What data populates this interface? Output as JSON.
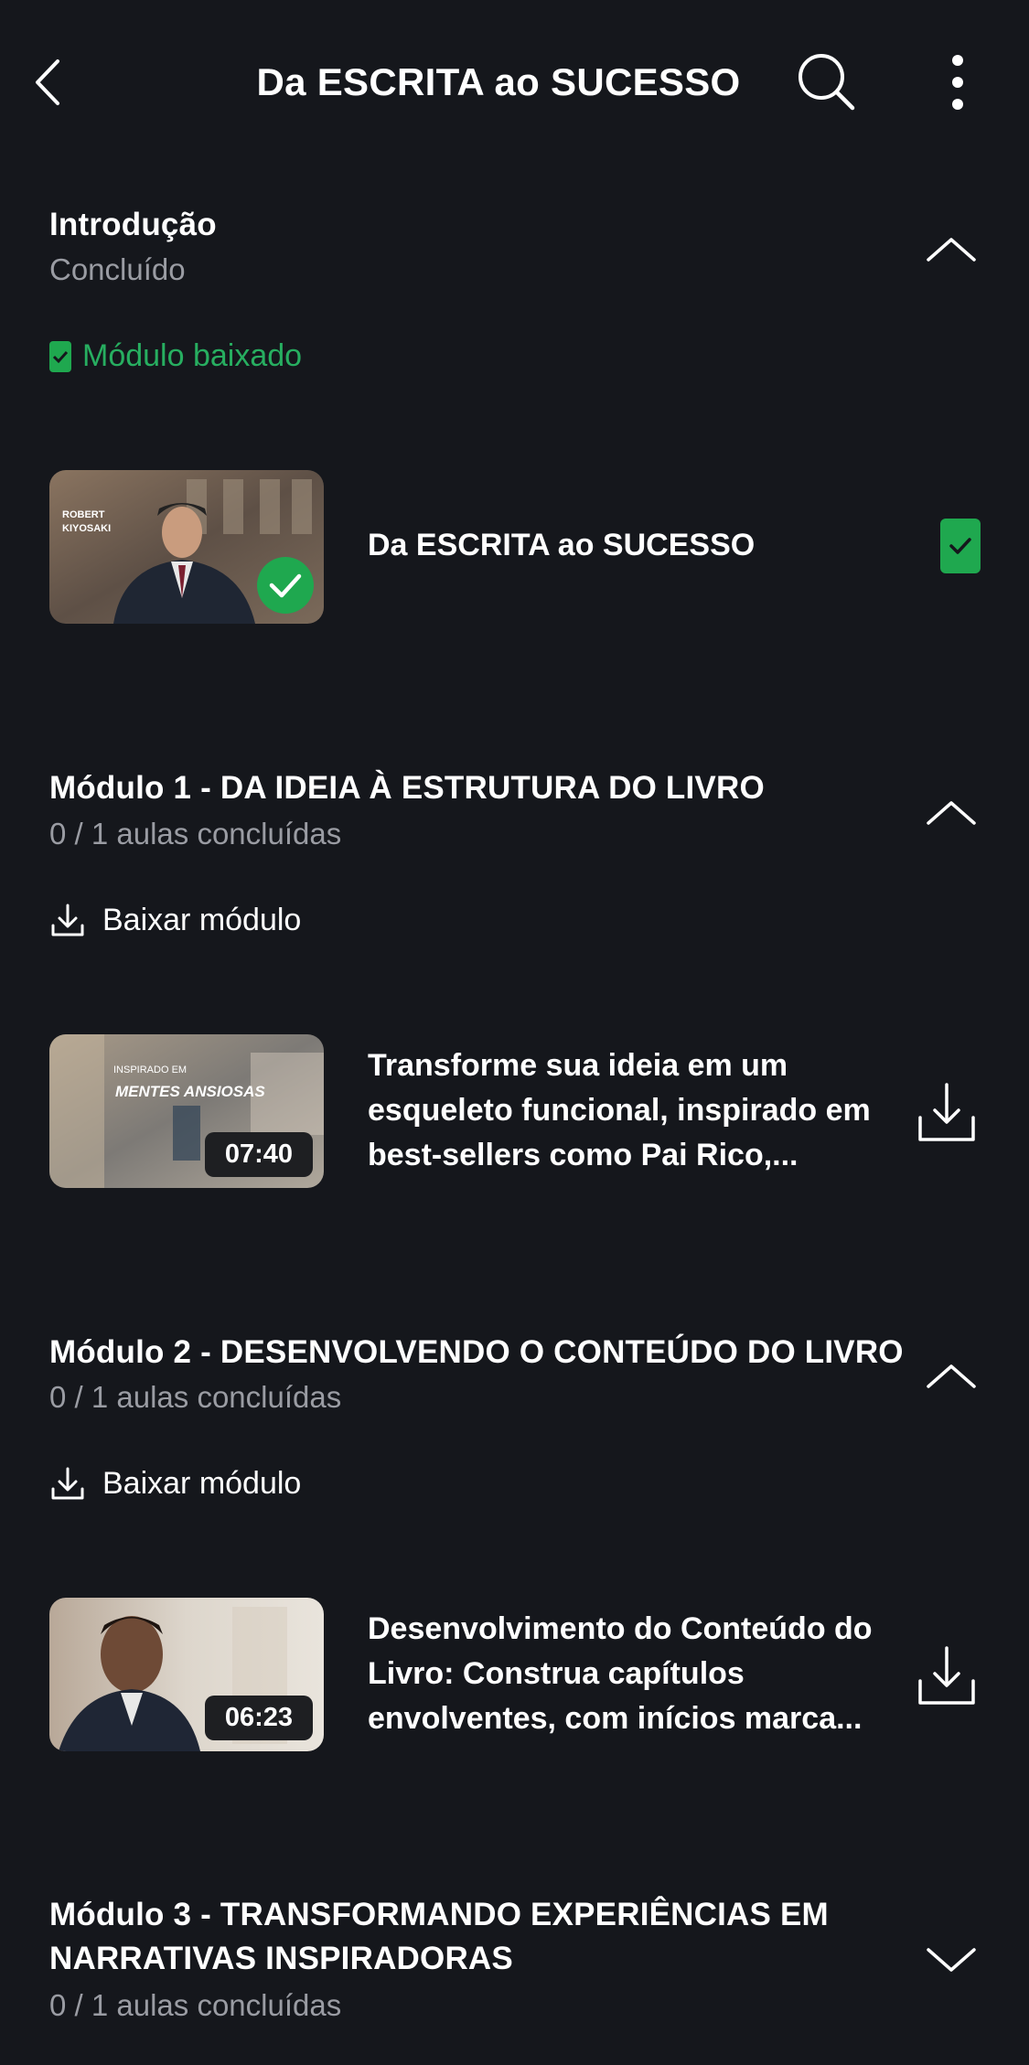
{
  "header": {
    "title": "Da ESCRITA ao SUCESSO"
  },
  "sections": [
    {
      "title": "Introdução",
      "subtitle": "Concluído",
      "downloaded_label": "Módulo baixado",
      "expanded": true,
      "lessons": [
        {
          "title": "Da ESCRITA ao SUCESSO",
          "completed": true
        }
      ]
    },
    {
      "title": "Módulo 1 - DA IDEIA À ESTRUTURA  DO LIVRO",
      "subtitle": "0 / 1 aulas concluídas",
      "download_label": "Baixar módulo",
      "expanded": true,
      "lessons": [
        {
          "title": "Transforme sua ideia em um esqueleto funcional, inspirado em best-sellers como Pai Rico,...",
          "duration": "07:40"
        }
      ]
    },
    {
      "title": "Módulo 2 - DESENVOLVENDO O  CONTEÚDO DO LIVRO",
      "subtitle": "0 / 1 aulas concluídas",
      "download_label": "Baixar módulo",
      "expanded": true,
      "lessons": [
        {
          "title": "Desenvolvimento do Conteúdo do Livro: Construa capítulos envolventes, com inícios marca...",
          "duration": "06:23"
        }
      ]
    },
    {
      "title": "Módulo 3 - TRANSFORMANDO  EXPERIÊNCIAS  EM NARRATIVAS  INSPIRADORAS",
      "subtitle": "0 / 1 aulas concluídas",
      "expanded": false
    }
  ],
  "thumbnails": {
    "intro": {
      "line1": "ROBERT",
      "line2": "KIYOSAKI"
    },
    "mod1": {
      "text1": "INSPIRADO EM",
      "text2": "MENTES ANSIOSAS"
    }
  },
  "colors": {
    "background": "#15171c",
    "accent_green": "#1fa84f",
    "muted_text": "#9a9ca3"
  },
  "icons": [
    "back-arrow-icon",
    "search-icon",
    "more-vertical-icon",
    "chevron-up-icon",
    "chevron-down-icon",
    "download-icon",
    "checkmark-icon"
  ]
}
